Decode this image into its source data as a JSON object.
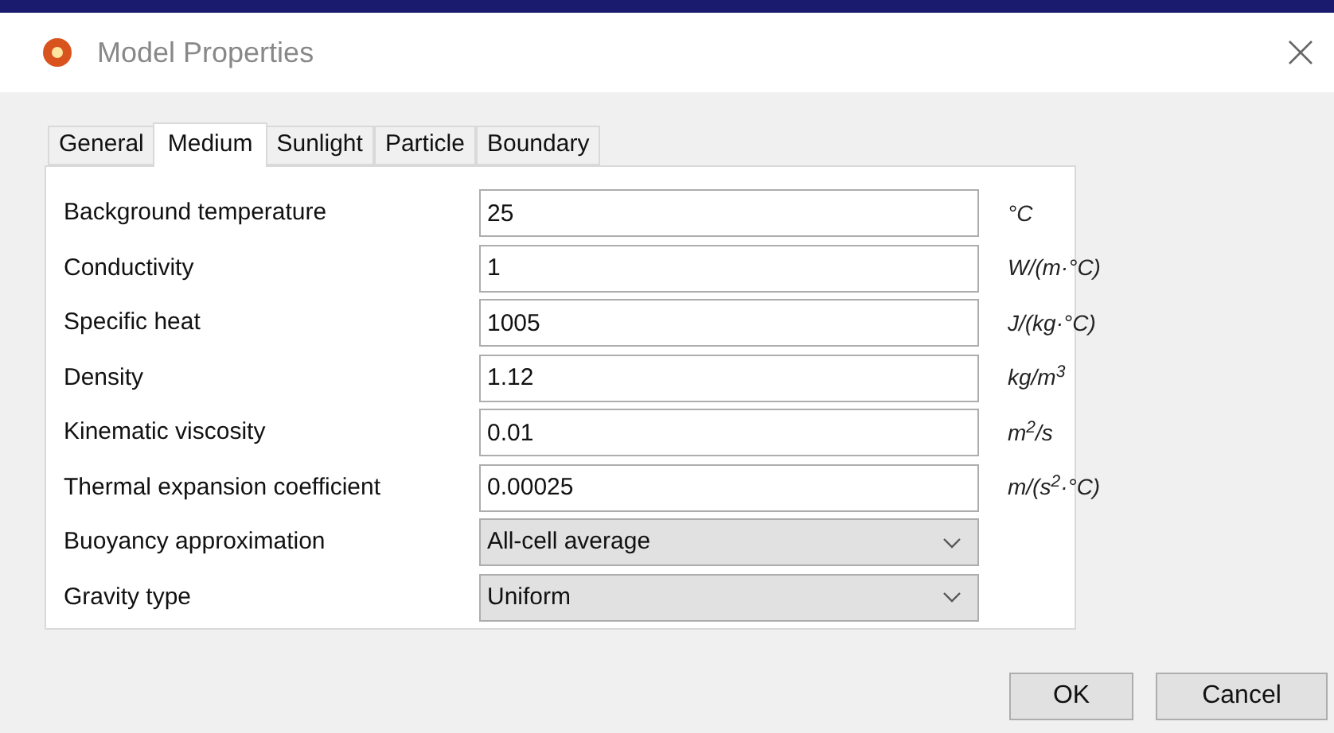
{
  "window": {
    "title": "Model Properties"
  },
  "tabs": [
    {
      "label": "General",
      "selected": false
    },
    {
      "label": "Medium",
      "selected": true
    },
    {
      "label": "Sunlight",
      "selected": false
    },
    {
      "label": "Particle",
      "selected": false
    },
    {
      "label": "Boundary",
      "selected": false
    }
  ],
  "fields": [
    {
      "kind": "text",
      "label": "Background temperature",
      "value": "25",
      "unit": "°C"
    },
    {
      "kind": "text",
      "label": "Conductivity",
      "value": "1",
      "unit": "W/(m·°C)"
    },
    {
      "kind": "text",
      "label": "Specific heat",
      "value": "1005",
      "unit": "J/(kg·°C)"
    },
    {
      "kind": "text",
      "label": "Density",
      "value": "1.12",
      "unit": "kg/m$^{3}$"
    },
    {
      "kind": "text",
      "label": "Kinematic viscosity",
      "value": "0.01",
      "unit": "m$^{2}$/s"
    },
    {
      "kind": "text",
      "label": "Thermal expansion coefficient",
      "value": "0.00025",
      "unit": "m/(s$^{2}$·°C)"
    },
    {
      "kind": "select",
      "label": "Buoyancy approximation",
      "value": "All-cell average"
    },
    {
      "kind": "select",
      "label": "Gravity type",
      "value": "Uniform"
    }
  ],
  "buttons": [
    "OK",
    "Cancel"
  ]
}
